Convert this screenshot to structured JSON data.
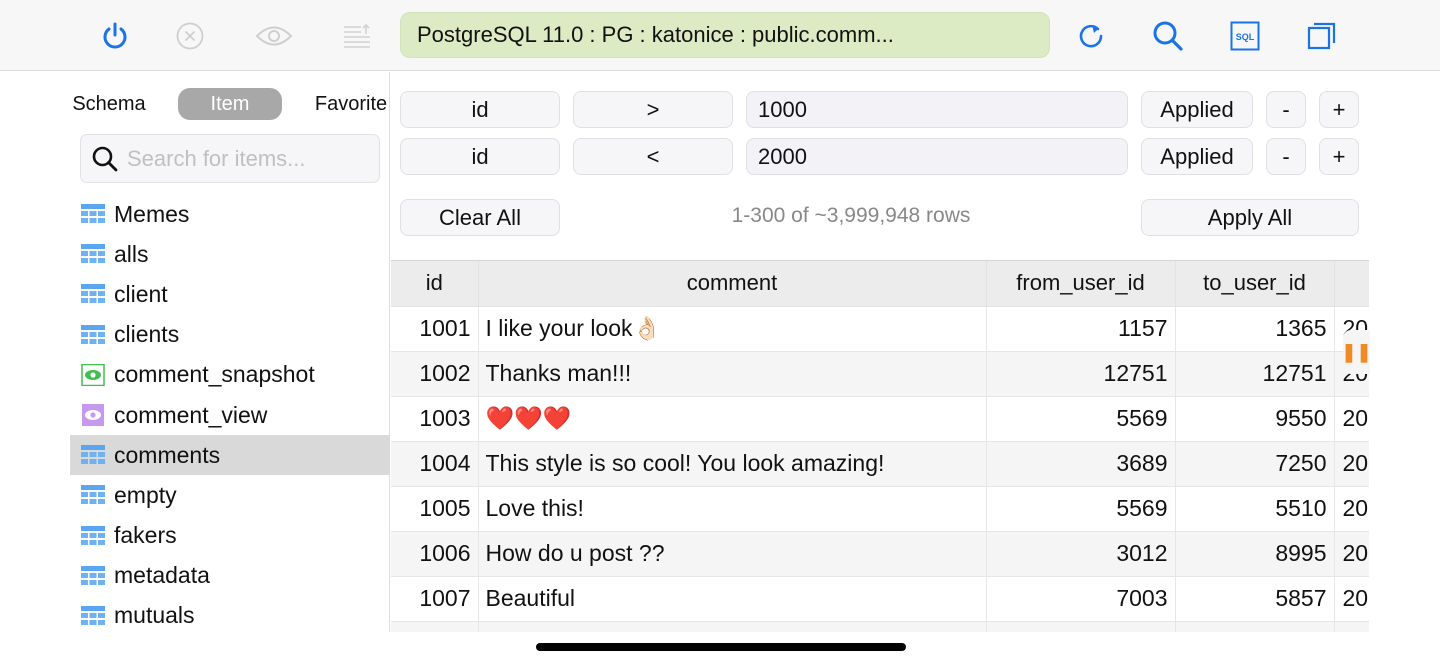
{
  "toolbar": {
    "title": "PostgreSQL 11.0 : PG : katonice : public.comm...",
    "colors": {
      "accent": "#1a73e8",
      "disabled": "#c8c8c8",
      "title_bg": "#dcebc4"
    },
    "left_icons": [
      "power-icon",
      "close-circle-icon",
      "eye-icon",
      "sort-lines-icon"
    ],
    "right_icons": [
      "refresh-icon",
      "search-icon",
      "sql-icon",
      "window-icon"
    ],
    "sql_label": "SQL"
  },
  "sidebar": {
    "tabs": [
      {
        "label": "Schema",
        "active": false
      },
      {
        "label": "Item",
        "active": true
      },
      {
        "label": "Favorite",
        "active": false
      }
    ],
    "search": {
      "placeholder": "Search for items...",
      "value": ""
    },
    "items": [
      {
        "label": "Memes",
        "type": "table",
        "selected": false
      },
      {
        "label": "alls",
        "type": "table",
        "selected": false
      },
      {
        "label": "client",
        "type": "table",
        "selected": false
      },
      {
        "label": "clients",
        "type": "table",
        "selected": false
      },
      {
        "label": "comment_snapshot",
        "type": "materialized-view",
        "selected": false
      },
      {
        "label": "comment_view",
        "type": "view",
        "selected": false
      },
      {
        "label": "comments",
        "type": "table",
        "selected": true
      },
      {
        "label": "empty",
        "type": "table",
        "selected": false
      },
      {
        "label": "fakers",
        "type": "table",
        "selected": false
      },
      {
        "label": "metadata",
        "type": "table",
        "selected": false
      },
      {
        "label": "mutuals",
        "type": "table",
        "selected": false
      }
    ]
  },
  "filters": [
    {
      "column": "id",
      "operator": ">",
      "value": "1000",
      "status": "Applied",
      "remove_label": "-",
      "add_label": "+"
    },
    {
      "column": "id",
      "operator": "<",
      "value": "2000",
      "status": "Applied",
      "remove_label": "-",
      "add_label": "+"
    }
  ],
  "actions": {
    "clear_all": "Clear All",
    "apply_all": "Apply All",
    "row_count": "1-300 of ~3,999,948 rows"
  },
  "grid": {
    "columns": [
      "id",
      "comment",
      "from_user_id",
      "to_user_id",
      ""
    ],
    "rows": [
      {
        "id": "1001",
        "comment": "I like your look👌🏻",
        "from_user_id": "1157",
        "to_user_id": "1365",
        "next": "20"
      },
      {
        "id": "1002",
        "comment": "Thanks man!!!",
        "from_user_id": "12751",
        "to_user_id": "12751",
        "next": "20"
      },
      {
        "id": "1003",
        "comment": "❤️❤️❤️",
        "from_user_id": "5569",
        "to_user_id": "9550",
        "next": "20"
      },
      {
        "id": "1004",
        "comment": "This style is so cool! You look amazing!",
        "from_user_id": "3689",
        "to_user_id": "7250",
        "next": "20"
      },
      {
        "id": "1005",
        "comment": "Love this!",
        "from_user_id": "5569",
        "to_user_id": "5510",
        "next": "20"
      },
      {
        "id": "1006",
        "comment": "How do u post ??",
        "from_user_id": "3012",
        "to_user_id": "8995",
        "next": "20"
      },
      {
        "id": "1007",
        "comment": "Beautiful",
        "from_user_id": "7003",
        "to_user_id": "5857",
        "next": "20"
      },
      {
        "id": "",
        "comment": "",
        "from_user_id": "",
        "to_user_id": "",
        "next": ""
      }
    ],
    "pause_icon": "pause-icon"
  }
}
